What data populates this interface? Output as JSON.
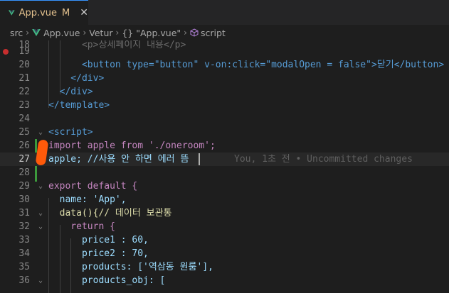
{
  "tab": {
    "label": "App.vue",
    "modified": "M",
    "close": "✕"
  },
  "breadcrumb": {
    "items": [
      "src",
      "App.vue",
      "Vetur",
      "\"App.vue\"",
      "script"
    ],
    "braces": "{}"
  },
  "editor": {
    "blame": "You, 1초 전 • Uncommitted changes",
    "lines": [
      {
        "n": "18",
        "text": "      <p>상세페이지 내용</p>"
      },
      {
        "n": "19",
        "text": ""
      },
      {
        "n": "20",
        "text": "      <button type=\"button\" v-on:click=\"modalOpen = false\">닫기</button>"
      },
      {
        "n": "21",
        "text": "    </div>"
      },
      {
        "n": "22",
        "text": "  </div>"
      },
      {
        "n": "23",
        "text": "</template>"
      },
      {
        "n": "24",
        "text": ""
      },
      {
        "n": "25",
        "text": "<script>"
      },
      {
        "n": "26",
        "text": "import apple from './oneroom';"
      },
      {
        "n": "27",
        "text": "apple; //사용 안 하면 에러 뜸"
      },
      {
        "n": "28",
        "text": ""
      },
      {
        "n": "29",
        "text": "export default {"
      },
      {
        "n": "30",
        "text": "  name: 'App',"
      },
      {
        "n": "31",
        "text": "  data(){// 데이터 보관통"
      },
      {
        "n": "32",
        "text": "    return {"
      },
      {
        "n": "33",
        "text": "      price1 : 60,"
      },
      {
        "n": "34",
        "text": "      price2 : 70,"
      },
      {
        "n": "35",
        "text": "      products: ['역삼동 원룸'],"
      },
      {
        "n": "36",
        "text": "      products_obj: ["
      }
    ]
  },
  "colors": {
    "accent": "#3794ff",
    "modified": "#e2c08d",
    "git_added": "#3c9a3c",
    "breakpoint": "#c72e2e",
    "annotation": "#ff5a0a"
  },
  "icons": {
    "file": "vue-logo-icon",
    "breakpoint": "breakpoint-dot-icon",
    "script": "script-cube-icon"
  }
}
